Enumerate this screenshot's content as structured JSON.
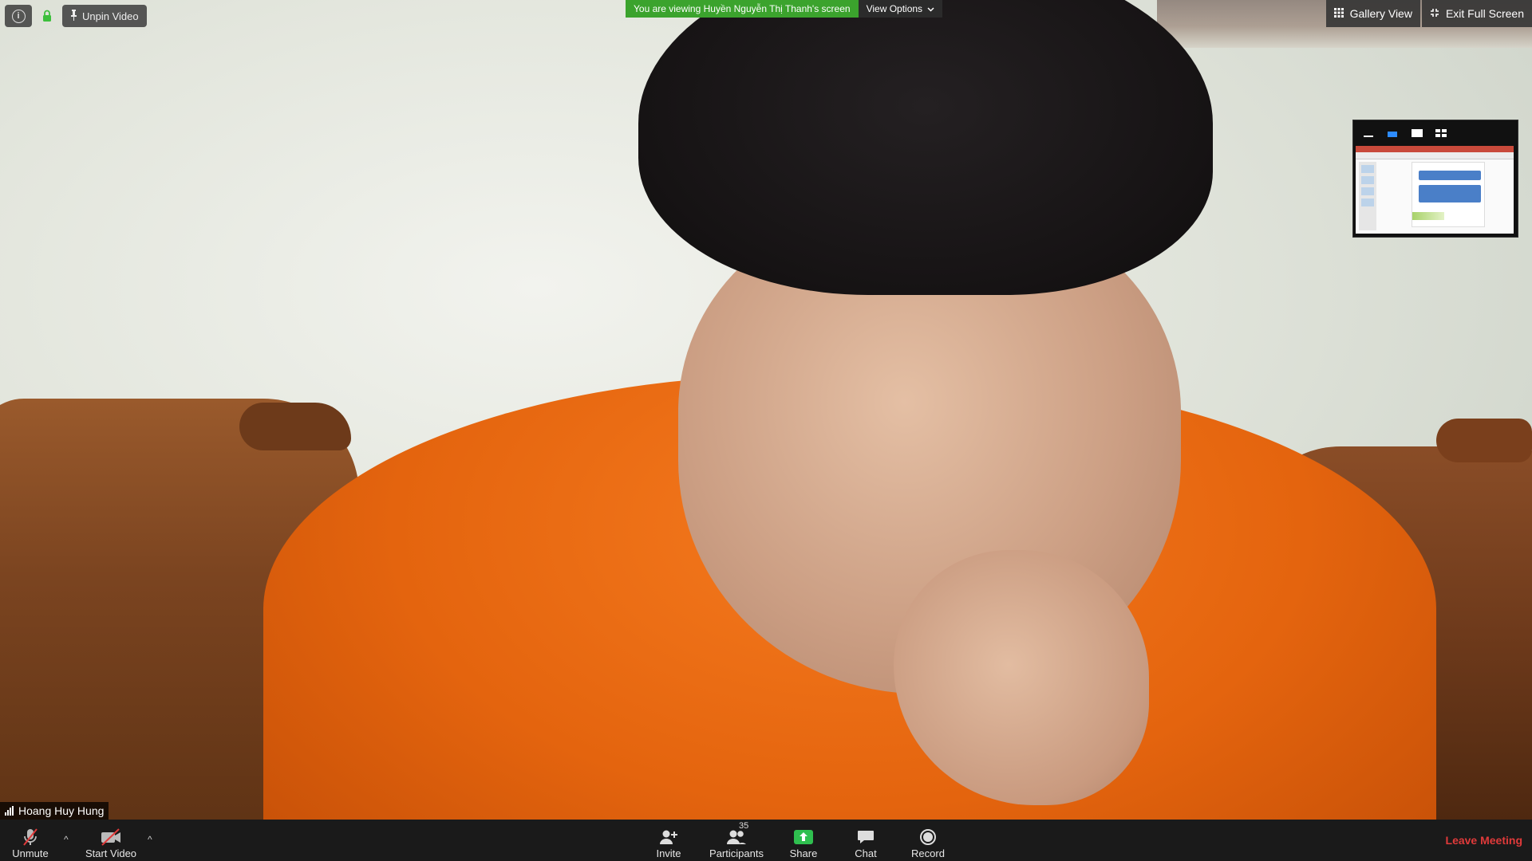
{
  "top_left": {
    "info_icon": "info-icon",
    "lock_icon": "lock-icon",
    "unpin_label": "Unpin Video",
    "pin_icon": "pin-icon"
  },
  "banner": {
    "viewing_text": "You are viewing Huyền Nguyễn Thị Thanh's screen",
    "view_options_label": "View Options"
  },
  "top_right": {
    "gallery_label": "Gallery View",
    "exit_full_label": "Exit Full Screen"
  },
  "participant": {
    "name": "Hoang Huy Hung"
  },
  "toolbar": {
    "unmute_label": "Unmute",
    "start_video_label": "Start Video",
    "invite_label": "Invite",
    "participants_label": "Participants",
    "participants_count": "35",
    "share_label": "Share",
    "chat_label": "Chat",
    "record_label": "Record",
    "leave_label": "Leave Meeting"
  },
  "colors": {
    "banner_green": "#3ba32d",
    "share_green": "#2fbf4f",
    "leave_red": "#e03a3a",
    "toolbar_bg": "#1a1a1a"
  }
}
